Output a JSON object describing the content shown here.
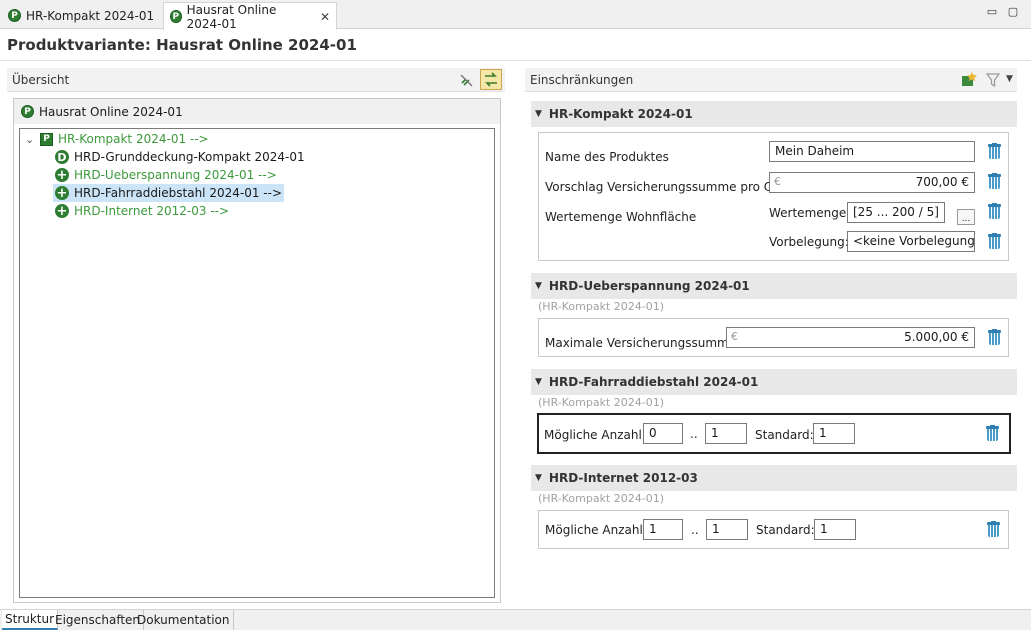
{
  "tabs": [
    {
      "label": "HR-Kompakt 2024-01"
    },
    {
      "label": "Hausrat Online 2024-01",
      "close": "✕"
    }
  ],
  "window_controls": {
    "minimize": "▭",
    "maximize": "▢"
  },
  "page_title": "Produktvariante: Hausrat Online 2024-01",
  "overview": {
    "title": "Übersicht",
    "root": "Hausrat Online 2024-01",
    "tree": [
      {
        "label": "HR-Kompakt 2024-01  -->",
        "icon": "P"
      },
      {
        "label": "HRD-Grunddeckung-Kompakt 2024-01",
        "icon": "D"
      },
      {
        "label": "HRD-Ueberspannung 2024-01  -->",
        "icon": "+"
      },
      {
        "label": "HRD-Fahrraddiebstahl 2024-01  -->",
        "icon": "+"
      },
      {
        "label": "HRD-Internet 2012-03  -->",
        "icon": "+"
      }
    ]
  },
  "restrictions": {
    "title": "Einschränkungen",
    "groups": [
      {
        "title": "HR-Kompakt 2024-01",
        "rows": {
          "name_label": "Name des Produktes",
          "name_value": "Mein Daheim",
          "sum_label": "Vorschlag Versicherungssumme pro QM",
          "sum_currency": "€",
          "sum_value": "700,00 €",
          "wm_label": "Wertemenge Wohnfläche",
          "wm_sub_label": "Wertemenge:",
          "wm_value": "[25 ... 200 / 5]",
          "wm_button": "...",
          "vb_label": "Vorbelegung:",
          "vb_value": "<keine Vorbelegung>"
        }
      },
      {
        "title": "HRD-Ueberspannung 2024-01",
        "sub": "(HR-Kompakt 2024-01)",
        "label": "Maximale Versicherungssumme",
        "currency": "€",
        "value": "5.000,00 €"
      },
      {
        "title": "HRD-Fahrraddiebstahl 2024-01",
        "sub": "(HR-Kompakt 2024-01)",
        "label": "Mögliche Anzahl",
        "min": "0",
        "sep": "..",
        "max": "1",
        "std_label": "Standard:",
        "std": "1"
      },
      {
        "title": "HRD-Internet 2012-03",
        "sub": "(HR-Kompakt 2024-01)",
        "label": "Mögliche Anzahl",
        "min": "1",
        "sep": "..",
        "max": "1",
        "std_label": "Standard:",
        "std": "1"
      }
    ]
  },
  "bottom_tabs": [
    {
      "label": "Struktur"
    },
    {
      "label": "Eigenschaften"
    },
    {
      "label": "Dokumentation"
    }
  ],
  "colors": {
    "green_text": "#3c9a3c",
    "icon_green": "#2e7d32",
    "trash_blue": "#4a9bc9",
    "selection": "#cce4f7"
  }
}
